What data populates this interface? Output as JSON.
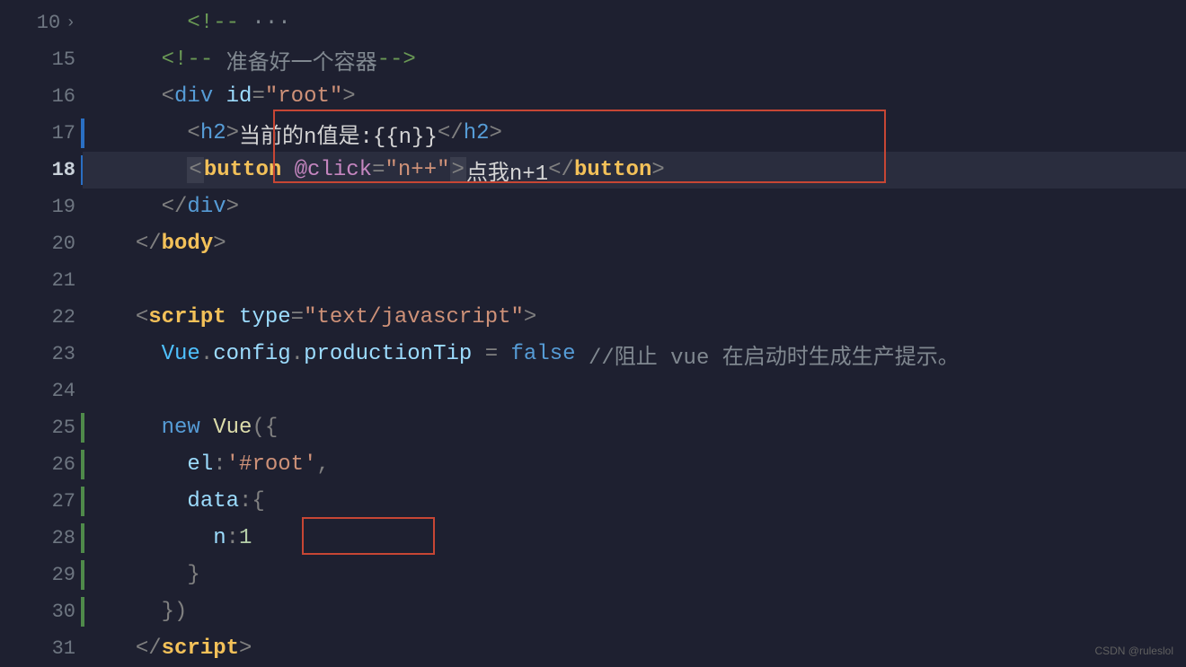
{
  "lines": [
    {
      "num": "10",
      "fold": true
    },
    {
      "num": "15"
    },
    {
      "num": "16"
    },
    {
      "num": "17",
      "mod": "blue"
    },
    {
      "num": "18",
      "mod": "blue",
      "current": true
    },
    {
      "num": "19"
    },
    {
      "num": "20"
    },
    {
      "num": "21"
    },
    {
      "num": "22"
    },
    {
      "num": "23"
    },
    {
      "num": "24"
    },
    {
      "num": "25",
      "mod": "green"
    },
    {
      "num": "26",
      "mod": "green"
    },
    {
      "num": "27",
      "mod": "green"
    },
    {
      "num": "28",
      "mod": "green"
    },
    {
      "num": "29",
      "mod": "green"
    },
    {
      "num": "30",
      "mod": "green"
    },
    {
      "num": "31"
    }
  ],
  "code": {
    "l10": {
      "comment_open": "<!--",
      "dots": " ···"
    },
    "l15": {
      "open": "<!--",
      "text": " 准备好一个容器",
      "close": "-->"
    },
    "l16": {
      "tag": "div",
      "attr": "id",
      "val": "\"root\""
    },
    "l17": {
      "tag": "h2",
      "text": "当前的n值是:{{n}}"
    },
    "l18": {
      "tag": "button",
      "attr": "@click",
      "val": "\"n++\"",
      "text": "点我n+1"
    },
    "l19": {
      "tag": "div"
    },
    "l20": {
      "tag": "body"
    },
    "l22": {
      "tag": "script",
      "attr": "type",
      "val": "\"text/javascript\""
    },
    "l23": {
      "obj": "Vue",
      "p1": "config",
      "p2": "productionTip",
      "val": "false",
      "comment": "//阻止 vue 在启动时生成生产提示。"
    },
    "l25": {
      "kw": "new",
      "cls": "Vue"
    },
    "l26": {
      "key": "el",
      "val": "'#root'"
    },
    "l27": {
      "key": "data"
    },
    "l28": {
      "key": "n",
      "val": "1"
    },
    "l31": {
      "tag": "script"
    }
  },
  "watermark": "CSDN @ruleslol"
}
